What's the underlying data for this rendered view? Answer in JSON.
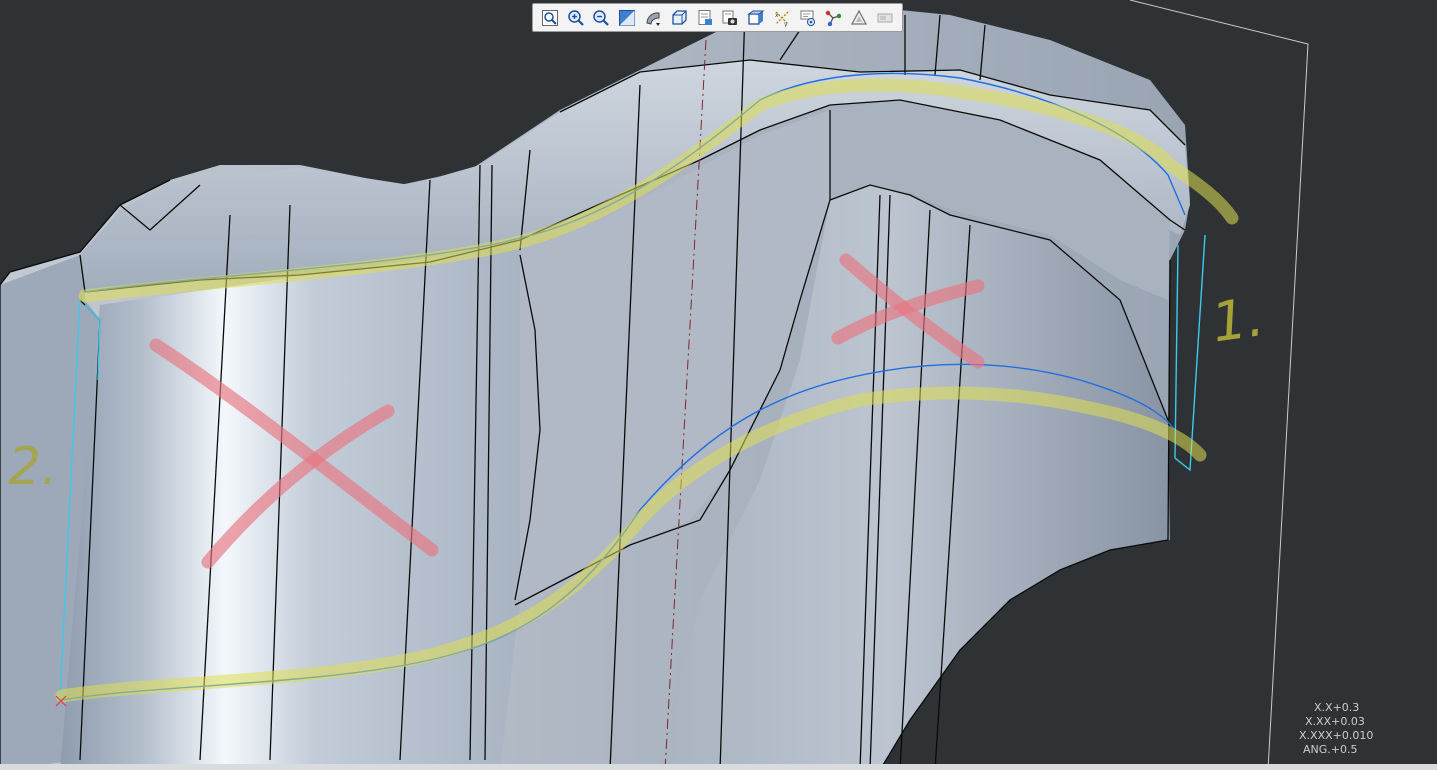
{
  "toolbar": {
    "buttons": [
      {
        "name": "refit",
        "icon": "refit-icon"
      },
      {
        "name": "zoom-in",
        "icon": "zoom-in-icon"
      },
      {
        "name": "zoom-out",
        "icon": "zoom-out-icon"
      },
      {
        "name": "repaint",
        "icon": "repaint-icon"
      },
      {
        "name": "display-style",
        "icon": "display-style-icon"
      },
      {
        "name": "saved-orientations",
        "icon": "saved-orientations-icon"
      },
      {
        "name": "view-manager",
        "icon": "view-manager-icon"
      },
      {
        "name": "appearance-gallery",
        "icon": "appearance-gallery-icon"
      },
      {
        "name": "perspective-view",
        "icon": "perspective-view-icon"
      },
      {
        "name": "datum-display",
        "icon": "datum-display-icon"
      },
      {
        "name": "annotation-display",
        "icon": "annotation-display-icon"
      },
      {
        "name": "spin-center",
        "icon": "spin-center-icon"
      },
      {
        "name": "analysis",
        "icon": "analysis-icon"
      },
      {
        "name": "simulation",
        "icon": "simulation-icon"
      }
    ]
  },
  "annotations": {
    "label_1": "1.",
    "label_2": "2."
  },
  "tolerances": {
    "x_x": "X.X+0.3",
    "x_xx": "X.XX+0.03",
    "x_xxx": "X.XXX+0.010",
    "ang": "ANG.+0.5"
  },
  "colors": {
    "background": "#2e3234",
    "model_surface": "#b4bfcc",
    "highlight_yellow": "#dede50",
    "cross_red": "#e8747f",
    "curve_blue": "#1f6fe0",
    "edge_cyan": "#3fc8ee",
    "label_ink": "#a6a237"
  }
}
